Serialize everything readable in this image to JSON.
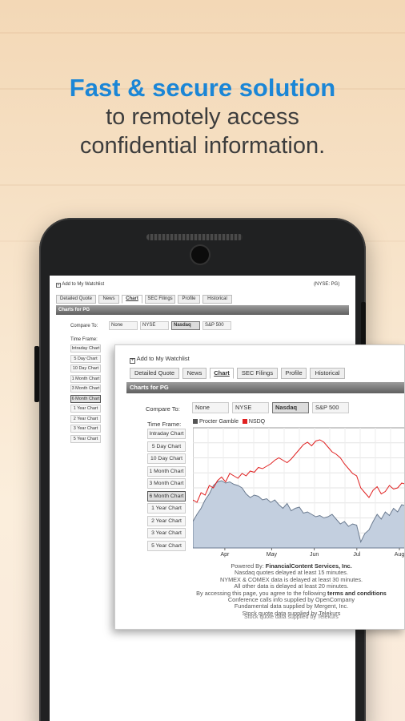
{
  "hero": {
    "line1": "Fast & secure solution",
    "line2": "to remotely access",
    "line3": "confidential information."
  },
  "colors": {
    "accent": "#1b86d6",
    "series_pg": "#555555",
    "series_nsdq": "#e02020",
    "area_fill": "#c3cfdf"
  },
  "screen": {
    "watchlist": "Add to My Watchlist",
    "ticker": "(NYSE: PG)",
    "tabs": [
      "Detailed Quote",
      "News",
      "Chart",
      "SEC Filings",
      "Profile",
      "Historical"
    ],
    "active_tab": "Chart",
    "section_title": "Charts for PG",
    "compare_label": "Compare To:",
    "compare_options": [
      "None",
      "NYSE",
      "Nasdaq",
      "S&P 500"
    ],
    "compare_selected": "Nasdaq",
    "timeframe_label": "Time Frame:",
    "timeframes": [
      "Intraday Chart",
      "5 Day Chart",
      "10 Day Chart",
      "1 Month Chart",
      "3 Month Chart",
      "6 Month Chart",
      "1 Year Chart",
      "2 Year Chart",
      "3 Year Chart",
      "5 Year Chart"
    ],
    "timeframe_selected": "6 Month Chart",
    "behind_letter": "F"
  },
  "overlay": {
    "watchlist": "Add to My Watchlist",
    "tabs": [
      "Detailed Quote",
      "News",
      "Chart",
      "SEC Filings",
      "Profile",
      "Historical"
    ],
    "section_title": "Charts for PG",
    "compare_label": "Compare To:",
    "compare_options": [
      "None",
      "NYSE",
      "Nasdaq",
      "S&P 500"
    ],
    "timeframe_label": "Time Frame:",
    "timeframes": [
      "Intraday Chart",
      "5 Day Chart",
      "10 Day Chart",
      "1 Month Chart",
      "3 Month Chart",
      "6 Month Chart",
      "1 Year Chart",
      "2 Year Chart",
      "3 Year Chart",
      "5 Year Chart"
    ],
    "credits": {
      "powered_prefix": "Powered By:",
      "powered_by": "FinancialContent Services, Inc.",
      "line2": "Nasdaq quotes delayed at least 15 minutes.",
      "line3": "NYMEX & COMEX data is delayed at least 30 minutes.",
      "line4": "All other data is delayed at least 20 minutes.",
      "line5_prefix": "By accessing this page, you agree to the following",
      "line5_link": "terms and conditions",
      "line6": "Conference calls info supplied by OpenCompany",
      "line7": "Fundamental data supplied by Mergent, Inc.",
      "line8": "Stock quote data supplied by Telekurs",
      "bleed": "Stock quote data supplied by Telekurs"
    }
  },
  "chart_data": {
    "type": "area",
    "title": "",
    "x_labels": [
      "Apr",
      "May",
      "Jun",
      "Jul",
      "Aug"
    ],
    "grid": true,
    "legend_position": "top-left",
    "series": [
      {
        "name": "Procter Gamble",
        "style": "area",
        "values": [
          0.22,
          0.28,
          0.33,
          0.4,
          0.45,
          0.52,
          0.55,
          0.56,
          0.54,
          0.55,
          0.53,
          0.52,
          0.5,
          0.45,
          0.42,
          0.44,
          0.43,
          0.4,
          0.41,
          0.38,
          0.4,
          0.36,
          0.33,
          0.37,
          0.31,
          0.33,
          0.34,
          0.29,
          0.3,
          0.28,
          0.26,
          0.27,
          0.25,
          0.26,
          0.28,
          0.24,
          0.2,
          0.22,
          0.18,
          0.2,
          0.19,
          0.05,
          0.12,
          0.15,
          0.22,
          0.28,
          0.24,
          0.3,
          0.27,
          0.33,
          0.3,
          0.36,
          0.35
        ]
      },
      {
        "name": "NSDQ",
        "style": "line",
        "values": [
          0.4,
          0.38,
          0.46,
          0.44,
          0.52,
          0.5,
          0.56,
          0.59,
          0.55,
          0.62,
          0.6,
          0.58,
          0.62,
          0.6,
          0.64,
          0.63,
          0.67,
          0.66,
          0.68,
          0.7,
          0.73,
          0.75,
          0.73,
          0.71,
          0.74,
          0.78,
          0.82,
          0.86,
          0.88,
          0.85,
          0.89,
          0.9,
          0.88,
          0.84,
          0.8,
          0.78,
          0.75,
          0.7,
          0.66,
          0.62,
          0.6,
          0.5,
          0.46,
          0.42,
          0.48,
          0.51,
          0.45,
          0.47,
          0.52,
          0.49,
          0.5,
          0.54,
          0.53
        ]
      }
    ]
  }
}
